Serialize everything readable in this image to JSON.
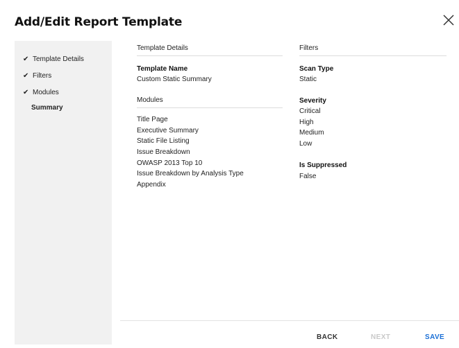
{
  "dialog": {
    "title": "Add/Edit Report Template",
    "close_icon": "close-icon"
  },
  "sidebar": {
    "steps": [
      {
        "label": "Template Details",
        "checked": true
      },
      {
        "label": "Filters",
        "checked": true
      },
      {
        "label": "Modules",
        "checked": true
      },
      {
        "label": "Summary",
        "checked": false,
        "current": true
      }
    ]
  },
  "summary": {
    "template_details": {
      "heading": "Template Details",
      "name_label": "Template Name",
      "name_value": "Custom Static Summary"
    },
    "modules": {
      "heading": "Modules",
      "items": [
        "Title Page",
        "Executive Summary",
        "Static File Listing",
        "Issue Breakdown",
        "OWASP 2013 Top 10",
        "Issue Breakdown by Analysis Type",
        "Appendix"
      ]
    },
    "filters": {
      "heading": "Filters",
      "scan_type_label": "Scan Type",
      "scan_type_value": "Static",
      "severity_label": "Severity",
      "severity_values": [
        "Critical",
        "High",
        "Medium",
        "Low"
      ],
      "suppressed_label": "Is Suppressed",
      "suppressed_value": "False"
    }
  },
  "footer": {
    "back_label": "BACK",
    "next_label": "NEXT",
    "save_label": "SAVE"
  },
  "colors": {
    "accent": "#1a6fd6",
    "disabled": "#c9c9c9",
    "sidebar_bg": "#f1f1f1"
  }
}
